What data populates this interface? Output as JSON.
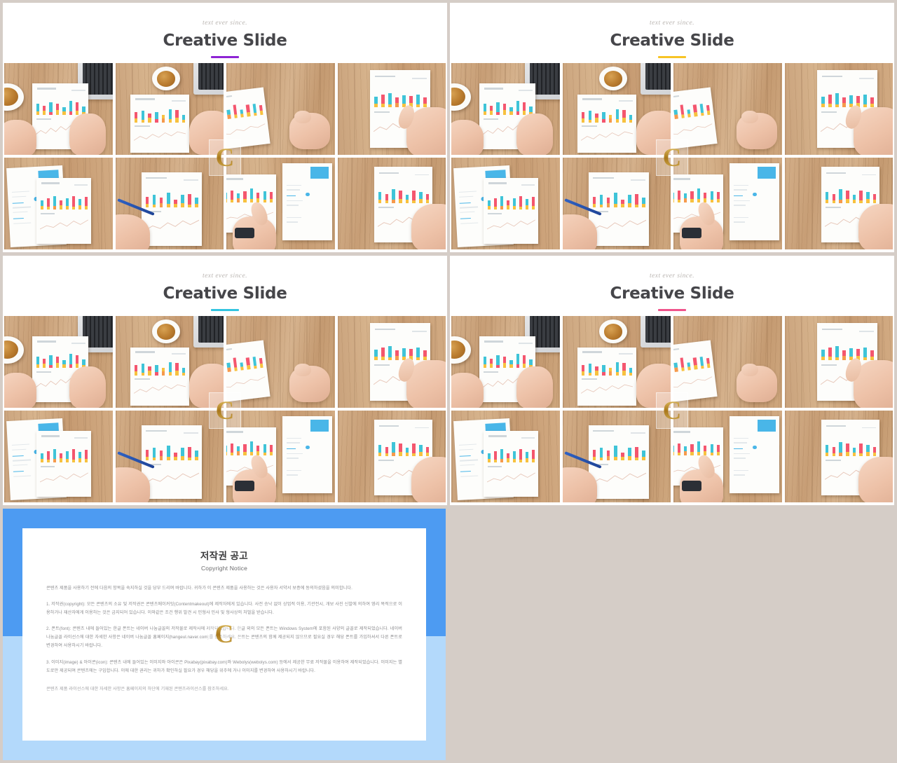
{
  "background_color": "#d5cdc7",
  "slides": [
    {
      "eyebrow": "text ever since.",
      "title": "Creative Slide",
      "accent_color": "#8e24d4"
    },
    {
      "eyebrow": "text ever since.",
      "title": "Creative Slide",
      "accent_color": "#f7c425"
    },
    {
      "eyebrow": "text ever since.",
      "title": "Creative Slide",
      "accent_color": "#33c4e0"
    },
    {
      "eyebrow": "text ever since.",
      "title": "Creative Slide",
      "accent_color": "#f0548b"
    }
  ],
  "watermark": {
    "letter": "C",
    "name": "copyright-watermark"
  },
  "copyright_panel": {
    "frame_color_top": "#4d9bf2",
    "frame_color_bottom": "#b3d9fb",
    "title": "저작권 공고",
    "subtitle": "Copyright Notice",
    "paragraphs": [
      "콘텐츠 제품을 사용하기 전에 다음의 항목을 숙지하실 것을 당부 드리며 바랍니다. 귀하가 이 콘텐츠 제품을 사용하는 것은 사용자 서약서 보증에 동의하셨음을 의미합니다.",
      "1. 저작권(copyright): 모든 콘텐츠의 소유 및 저작권은 콘텐츠메이커잇(Contentmakeout)에 제작자에게 있습니다. 사전 승낙 없이 상업적 이용, 기관전시, 개보 사진 신발에 의하여 영리 목적으로 이용하거나 재산자에게 이용하는 것은 금지되어 있습니다. 이와같은 조건 행위 발견 시 민형사 민사 및 형사상의 처벌을 받습니다.",
      "2. 폰트(font): 콘텐츠 내에 들어있는 한글 폰트는 네이버 나눔글꼴의 저작물로 제작사에 제작되었습니다. 한글 외의 모든 폰트는 Windows System에 포함된 사양의 글꼴로 제작되었습니다. 네이버 나눔글꼴 라이선스에 대한 자세한 사항은 네이버 나눔글꼴 홈페이지(hangeul.naver.com)를 참조하세요. 폰트는 콘텐츠의 함께 제공되지 않으므로 필요실 경우 해당 폰트를 가입하셔서 다른 폰트로 변경하여 사용하시기 바랍니다.",
      "3. 이미지(image) & 아이콘(icon): 콘텐츠 내에 들어있는 이미지와 아이콘은 Pixabay(pixabay.com)와 Webolys(webolys.com) 등에서 제공한 무료 저작물을 이용하여 제작되었습니다. 이미지는 별도로만 제공되며 콘텐츠에는 구입합니다. 이에 대한 권리는 귀하가 확인하실 필요가 경우 해당을 위주에 거나 이미지를 변경하여 사용하시기 바랍니다.",
      "콘텐츠 제품 라이선스에 대한 자세한 사항은 홈페이지의 하단에 기재된 콘텐츠라이선스를 참조하세요."
    ]
  },
  "photo_cells": {
    "count_per_slide": 8,
    "columns": 4,
    "rows": 2,
    "scene": "overhead-desk-photos-with-bar-chart-reports"
  }
}
